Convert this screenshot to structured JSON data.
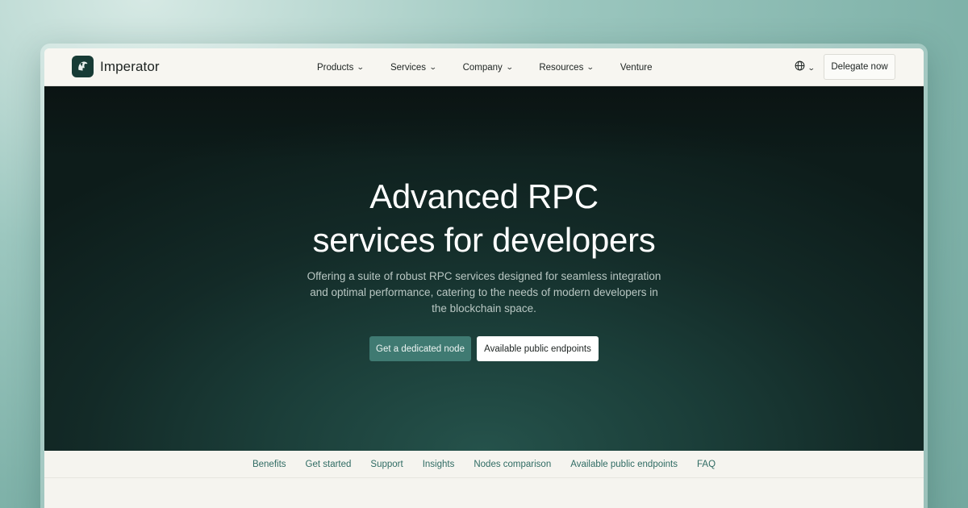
{
  "brand": {
    "name": "Imperator",
    "logo_icon": "spartan-helmet-icon"
  },
  "nav": {
    "items": [
      {
        "label": "Products",
        "has_dropdown": true
      },
      {
        "label": "Services",
        "has_dropdown": true
      },
      {
        "label": "Company",
        "has_dropdown": true
      },
      {
        "label": "Resources",
        "has_dropdown": true
      },
      {
        "label": "Venture",
        "has_dropdown": false
      }
    ],
    "language_icon": "globe-icon",
    "cta_label": "Delegate now"
  },
  "hero": {
    "title_line1": "Advanced RPC",
    "title_line2": "services for developers",
    "subtitle": "Offering a suite of robust RPC services designed for seamless integration and optimal performance, catering to the needs of modern developers in the blockchain space.",
    "primary_button": "Get a dedicated node",
    "secondary_button": "Available public endpoints"
  },
  "subnav": {
    "items": [
      "Benefits",
      "Get started",
      "Support",
      "Insights",
      "Nodes comparison",
      "Available public endpoints",
      "FAQ"
    ]
  },
  "colors": {
    "accent": "#3f7a72",
    "hero_bg": "#132a27",
    "page_bg": "#f5f4ef",
    "link": "#2f6b63"
  }
}
